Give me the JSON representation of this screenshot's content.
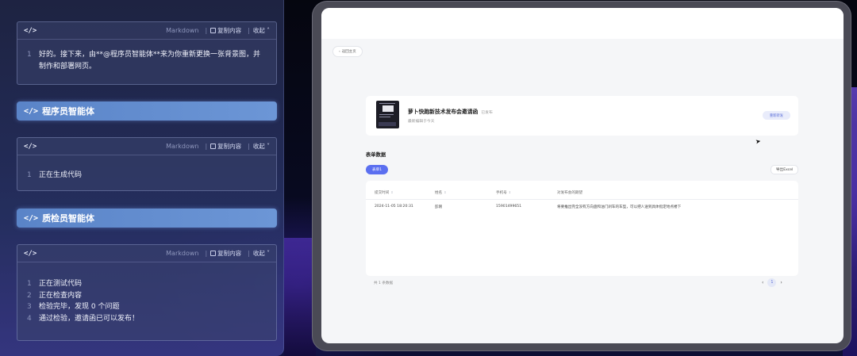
{
  "code_blocks": [
    {
      "lang": "Markdown",
      "copy_label": "复制内容",
      "fold_label": "收起",
      "lines": [
        {
          "num": "1",
          "text": "好的。接下来，由**@程序员智能体**来为你重新更换一张背景图，并"
        },
        {
          "num": "",
          "text": "制作和部署网页。"
        }
      ]
    },
    {
      "lang": "Markdown",
      "copy_label": "复制内容",
      "fold_label": "收起",
      "lines": [
        {
          "num": "1",
          "text": "正在生成代码"
        }
      ]
    },
    {
      "lang": "Markdown",
      "copy_label": "复制内容",
      "fold_label": "收起",
      "lines": [
        {
          "num": "1",
          "text": "正在测试代码"
        },
        {
          "num": "2",
          "text": "正在检查内容"
        },
        {
          "num": "3",
          "text": "检验完毕，发现 0 个问题"
        },
        {
          "num": "4",
          "text": "通过检验，邀请函已可以发布！"
        }
      ]
    }
  ],
  "agents": [
    {
      "tag": "</>",
      "name": "程序员智能体"
    },
    {
      "tag": "</>",
      "name": "质检员智能体"
    }
  ],
  "code_tag": "</>",
  "browser": {
    "back_label": "返回主页",
    "event": {
      "title": "萝卜快跑新技术发布会邀请函",
      "status": "已发布",
      "subtitle": "最新编辑于今天",
      "repost_label": "重新转发"
    },
    "section_title": "表单数据",
    "form_tab": "表单1",
    "export_label": "导出Excel",
    "table": {
      "headers": [
        "提交时间",
        "姓名",
        "手机号",
        "对发布会的期望"
      ],
      "rows": [
        [
          "2024-11-05 18:20:31",
          "彭刚",
          "15901499651",
          "将要推出完全没有方向盘和油门刹车的车型，可以把人送到具体指定地点楼下"
        ]
      ]
    },
    "total_text": "共 1 条数据",
    "pagination": {
      "prev": "‹",
      "current": "1",
      "next": "›"
    }
  }
}
